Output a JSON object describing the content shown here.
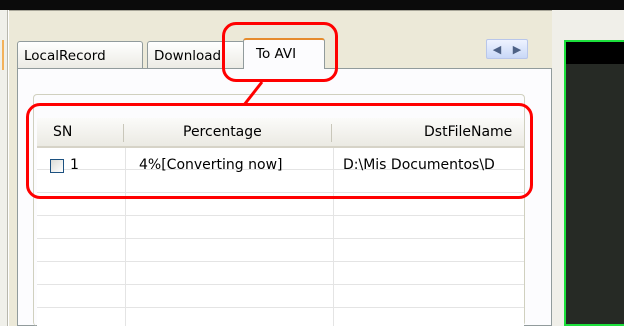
{
  "tabs": [
    {
      "label": "LocalRecord",
      "active": false
    },
    {
      "label": "Download",
      "active": false
    },
    {
      "label": "To AVI",
      "active": true
    }
  ],
  "tab_scroll": {
    "left_icon": "chevron-left-icon",
    "right_icon": "chevron-right-icon"
  },
  "table": {
    "columns": [
      "SN",
      "Percentage",
      "DstFileName"
    ],
    "rows": [
      {
        "checked": false,
        "sn": "1",
        "percentage": "4%[Converting now]",
        "dst_file_name": "D:\\Mis Documentos\\D"
      }
    ]
  },
  "annotations": {
    "color": "#ff0000"
  },
  "colors": {
    "active_tab_accent": "#e68b2c",
    "video_border": "#1ce03c"
  }
}
